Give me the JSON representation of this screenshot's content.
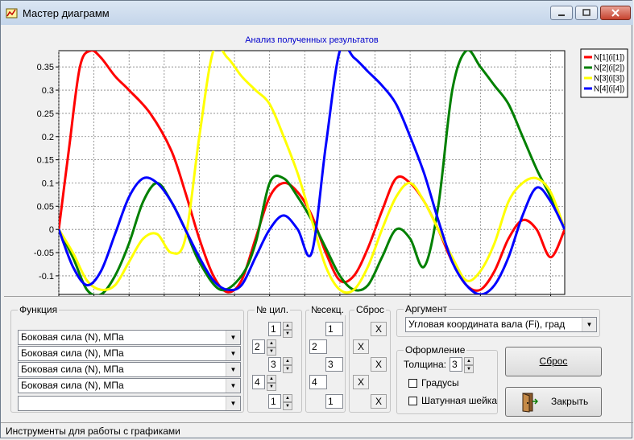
{
  "window": {
    "title": "Мастер диаграмм"
  },
  "chart_data": {
    "type": "line",
    "title": "Анализ полученных результатов",
    "xlim": [
      0,
      720
    ],
    "ylim": [
      -0.14,
      0.385
    ],
    "xticks": [
      0,
      50,
      100,
      150,
      200,
      250,
      300,
      350,
      400,
      450,
      500,
      550,
      600,
      650,
      700
    ],
    "yticks": [
      -0.1,
      -0.05,
      0,
      0.05,
      0.1,
      0.15,
      0.2,
      0.25,
      0.3,
      0.35
    ],
    "ytick_labels": [
      "-0.1",
      "-0.05",
      "0",
      "0.05",
      "0.1",
      "0.15",
      "0.2",
      "0.25",
      "0.3",
      "0.35"
    ],
    "grid": true,
    "legend_position": "right",
    "series": [
      {
        "name": "N[1](i[1])",
        "color": "#ff0000",
        "x": [
          0,
          15,
          30,
          45,
          60,
          80,
          100,
          130,
          160,
          180,
          200,
          220,
          240,
          260,
          280,
          300,
          320,
          340,
          360,
          380,
          400,
          420,
          440,
          460,
          480,
          500,
          520,
          540,
          560,
          580,
          600,
          620,
          640,
          660,
          680,
          700,
          720
        ],
        "y": [
          0,
          0.18,
          0.35,
          0.385,
          0.37,
          0.33,
          0.3,
          0.25,
          0.17,
          0.08,
          -0.02,
          -0.1,
          -0.135,
          -0.11,
          -0.02,
          0.07,
          0.1,
          0.08,
          0.03,
          -0.05,
          -0.11,
          -0.1,
          -0.04,
          0.04,
          0.11,
          0.1,
          0.06,
          0.0,
          -0.07,
          -0.12,
          -0.13,
          -0.09,
          -0.02,
          0.02,
          0.0,
          -0.06,
          0.0
        ]
      },
      {
        "name": "N[2](i[2])",
        "color": "#008000",
        "x": [
          0,
          20,
          40,
          60,
          80,
          100,
          120,
          140,
          160,
          180,
          200,
          230,
          260,
          280,
          300,
          320,
          340,
          360,
          380,
          400,
          420,
          440,
          460,
          480,
          500,
          520,
          540,
          560,
          580,
          600,
          620,
          640,
          660,
          680,
          700,
          720
        ],
        "y": [
          0,
          -0.06,
          -0.13,
          -0.14,
          -0.1,
          -0.03,
          0.06,
          0.1,
          0.06,
          0.0,
          -0.07,
          -0.13,
          -0.1,
          -0.03,
          0.1,
          0.11,
          0.07,
          0.02,
          -0.04,
          -0.1,
          -0.13,
          -0.12,
          -0.06,
          0.0,
          -0.02,
          -0.08,
          0.05,
          0.3,
          0.385,
          0.35,
          0.31,
          0.27,
          0.2,
          0.13,
          0.07,
          0.0
        ]
      },
      {
        "name": "N[3](i[3])",
        "color": "#ffff00",
        "x": [
          0,
          20,
          40,
          60,
          80,
          100,
          120,
          140,
          160,
          180,
          200,
          220,
          240,
          260,
          280,
          300,
          320,
          340,
          360,
          380,
          400,
          420,
          440,
          460,
          480,
          500,
          520,
          540,
          560,
          580,
          600,
          620,
          640,
          660,
          680,
          700,
          720
        ],
        "y": [
          0,
          -0.05,
          -0.11,
          -0.13,
          -0.12,
          -0.07,
          -0.02,
          -0.01,
          -0.05,
          -0.02,
          0.2,
          0.385,
          0.37,
          0.33,
          0.3,
          0.27,
          0.2,
          0.12,
          0.02,
          -0.08,
          -0.13,
          -0.13,
          -0.08,
          0.0,
          0.07,
          0.1,
          0.06,
          0.0,
          -0.06,
          -0.11,
          -0.09,
          -0.03,
          0.06,
          0.1,
          0.11,
          0.08,
          0.0
        ]
      },
      {
        "name": "N[4](i[4])",
        "color": "#0000ff",
        "x": [
          0,
          20,
          40,
          60,
          80,
          100,
          120,
          140,
          160,
          180,
          200,
          220,
          240,
          260,
          280,
          300,
          320,
          340,
          360,
          380,
          400,
          420,
          440,
          460,
          480,
          500,
          520,
          540,
          560,
          580,
          600,
          620,
          640,
          660,
          680,
          700,
          720
        ],
        "y": [
          0,
          -0.08,
          -0.12,
          -0.09,
          -0.01,
          0.07,
          0.11,
          0.1,
          0.06,
          0.0,
          -0.06,
          -0.11,
          -0.13,
          -0.12,
          -0.06,
          0.0,
          0.03,
          0.0,
          -0.05,
          0.18,
          0.385,
          0.37,
          0.34,
          0.31,
          0.27,
          0.2,
          0.12,
          0.02,
          -0.07,
          -0.12,
          -0.14,
          -0.12,
          -0.06,
          0.03,
          0.09,
          0.06,
          0.0
        ]
      }
    ]
  },
  "functions": {
    "label": "Функция",
    "rows": [
      {
        "value": "Боковая сила (N), МПа"
      },
      {
        "value": "Боковая сила (N), МПа"
      },
      {
        "value": "Боковая сила (N), МПа"
      },
      {
        "value": "Боковая сила (N), МПа"
      },
      {
        "value": ""
      }
    ]
  },
  "cylinders": {
    "label": "№ цил.",
    "values": [
      "1",
      "2",
      "3",
      "4",
      "1"
    ]
  },
  "sections": {
    "label": "№секц.",
    "values": [
      "1",
      "2",
      "3",
      "4",
      "1"
    ]
  },
  "reset_group": {
    "label": "Сброс",
    "x": "X"
  },
  "argument": {
    "label": "Аргумент",
    "value": "Угловая координата вала (Fi), град"
  },
  "design": {
    "label": "Оформление",
    "thickness_label": "Толщина:",
    "thickness_value": "3",
    "degrees_label": "Градусы",
    "crank_label": "Шатунная шейка"
  },
  "buttons": {
    "reset": "Сброс",
    "close": "Закрыть"
  },
  "status": {
    "text": "Инструменты для работы  с графиками"
  }
}
